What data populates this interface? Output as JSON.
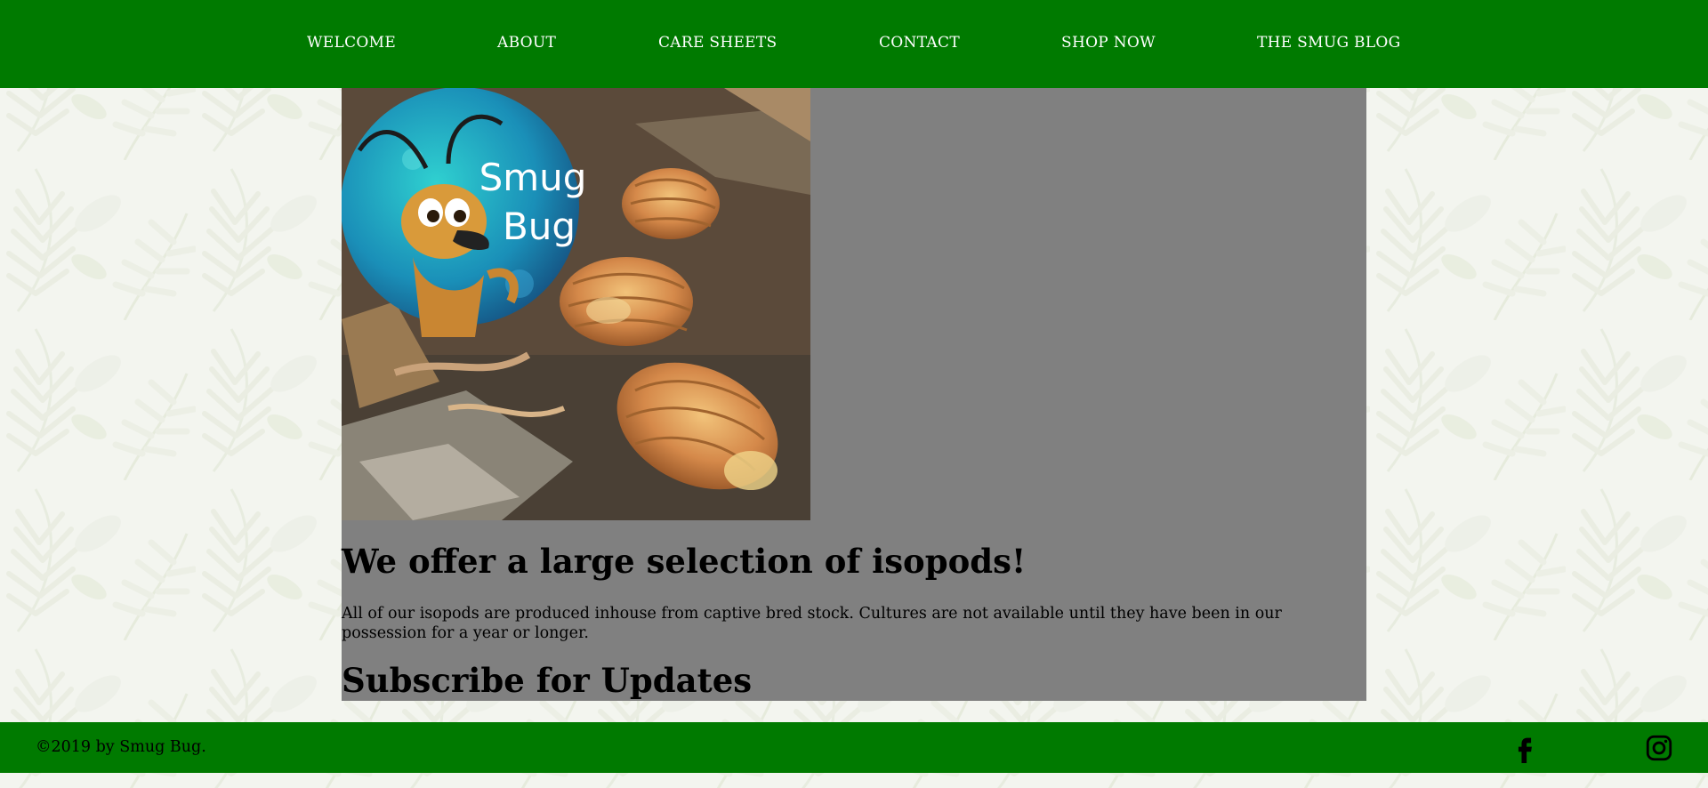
{
  "nav": {
    "items": [
      {
        "label": "WELCOME"
      },
      {
        "label": "ABOUT"
      },
      {
        "label": "CARE SHEETS"
      },
      {
        "label": "CONTACT"
      },
      {
        "label": "SHOP NOW"
      },
      {
        "label": "THE SMUG BLOG"
      }
    ]
  },
  "hero": {
    "logo_text_line1": "Smug",
    "logo_text_line2": "Bug"
  },
  "main": {
    "headline": "We offer a large selection of isopods!",
    "body": "All of our isopods are produced inhouse from captive bred stock. Cultures are not available until they have been in our possession for a year or longer.",
    "subscribe_heading": "Subscribe for Updates"
  },
  "footer": {
    "copyright": "©2019 by Smug Bug.",
    "social": [
      "facebook-icon",
      "instagram-icon"
    ]
  },
  "colors": {
    "brand_green": "#007a00",
    "panel_gray": "#808080",
    "text": "#000000",
    "nav_text": "#ffffff"
  }
}
